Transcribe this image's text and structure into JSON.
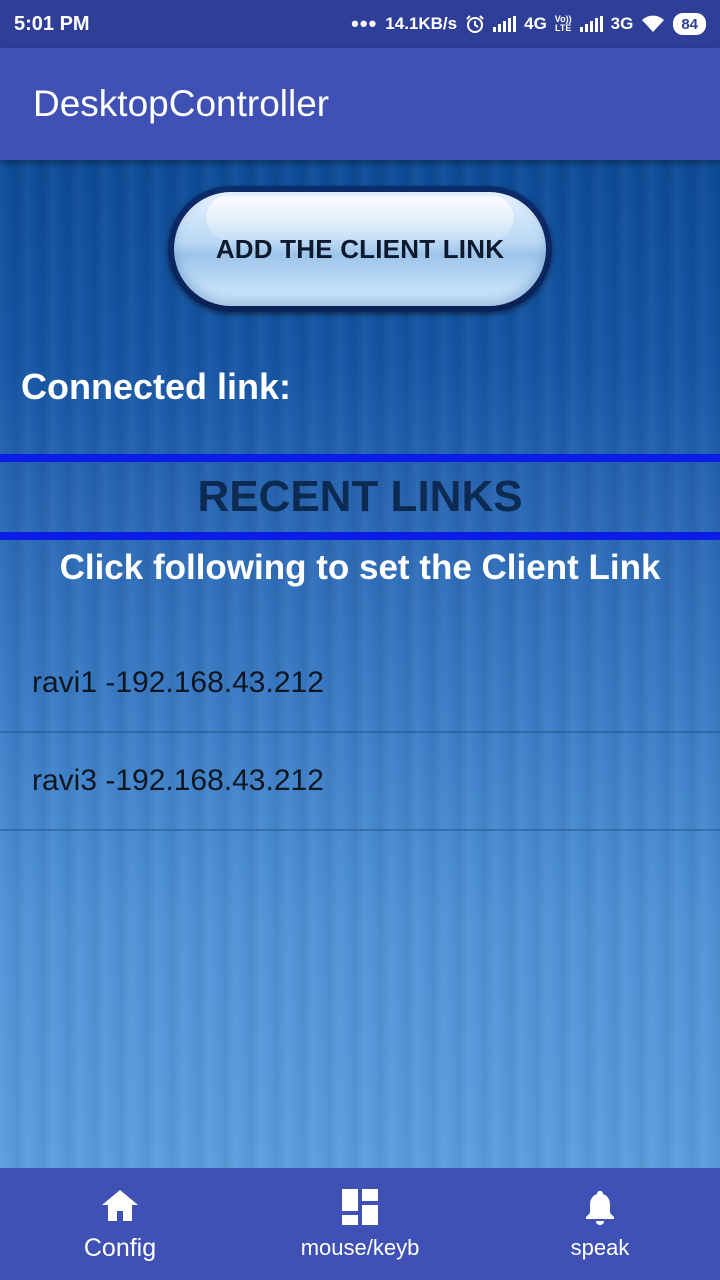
{
  "status_bar": {
    "time": "5:01 PM",
    "dots": "•••",
    "speed": "14.1KB/s",
    "network1": "4G",
    "volte_top": "Vo))",
    "volte_bottom": "LTE",
    "network2": "3G",
    "battery": "84",
    "icons": [
      "alarm-icon",
      "signal-icon",
      "wifi-icon",
      "battery-icon"
    ]
  },
  "app_bar": {
    "title": "DesktopController"
  },
  "main": {
    "add_button_label": "ADD THE CLIENT LINK",
    "connected_label": "Connected link:",
    "recent_heading": "RECENT LINKS",
    "instruction": "Click following to set the Client Link",
    "links": [
      {
        "text": "ravi1 -192.168.43.212"
      },
      {
        "text": "ravi3 -192.168.43.212"
      }
    ]
  },
  "bottom_nav": {
    "items": [
      {
        "label": "Config",
        "icon": "home-icon",
        "active": true
      },
      {
        "label": "mouse/keyb",
        "icon": "dashboard-icon",
        "active": false
      },
      {
        "label": "speak",
        "icon": "bell-icon",
        "active": false
      }
    ]
  },
  "colors": {
    "primary": "#3f51b5",
    "status_bar": "#2f3f98",
    "divider": "#0a1de8",
    "heading": "#0c2a52"
  }
}
